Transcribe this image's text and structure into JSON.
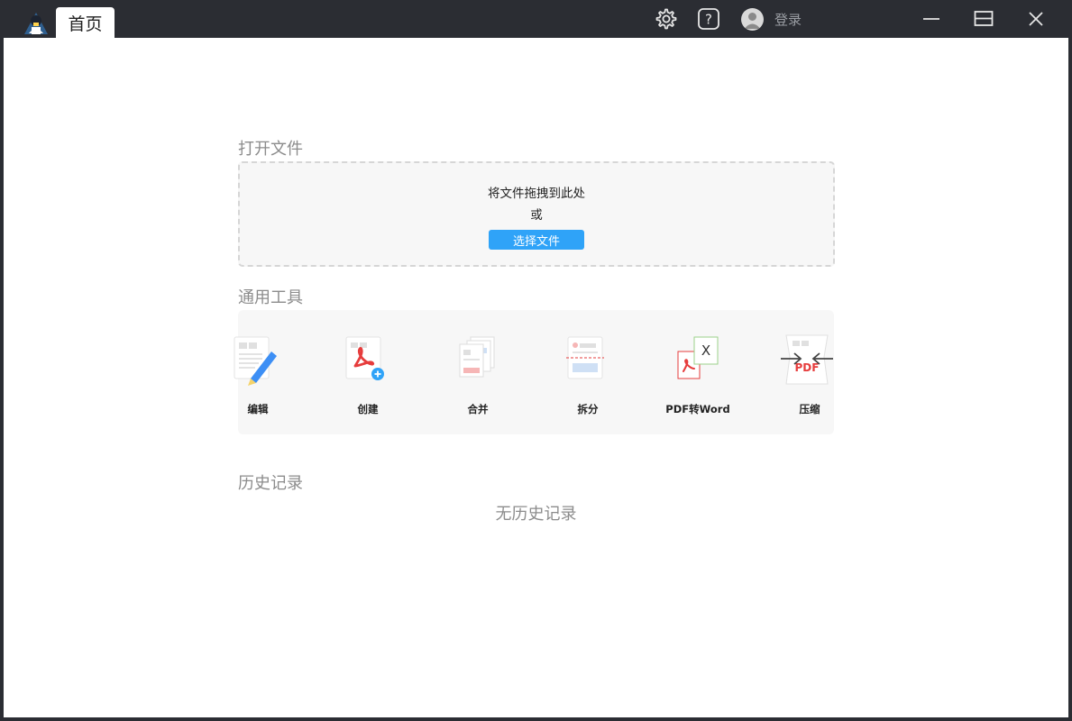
{
  "titlebar": {
    "tab_label": "首页",
    "login_label": "登录",
    "icons": [
      "app-logo-icon",
      "settings-gear-icon",
      "help-question-icon",
      "user-avatar-icon",
      "minimize-icon",
      "maximize-icon",
      "close-icon"
    ]
  },
  "open_file": {
    "title": "打开文件",
    "drag_hint": "将文件拖拽到此处",
    "or_text": "或",
    "choose_button": "选择文件"
  },
  "tools": {
    "title": "通用工具",
    "items": [
      {
        "label": "编辑",
        "icon": "edit-pencil-icon"
      },
      {
        "label": "创建",
        "icon": "create-pdf-icon"
      },
      {
        "label": "合并",
        "icon": "merge-icon"
      },
      {
        "label": "拆分",
        "icon": "split-icon"
      },
      {
        "label": "PDF转Word",
        "icon": "pdf-to-word-icon"
      },
      {
        "label": "压缩",
        "icon": "compress-icon"
      }
    ]
  },
  "history": {
    "title": "历史记录",
    "empty_text": "无历史记录"
  },
  "colors": {
    "titlebar": "#2b2d33",
    "accent": "#2fa3f8",
    "pdf_red": "#e63c3c"
  }
}
